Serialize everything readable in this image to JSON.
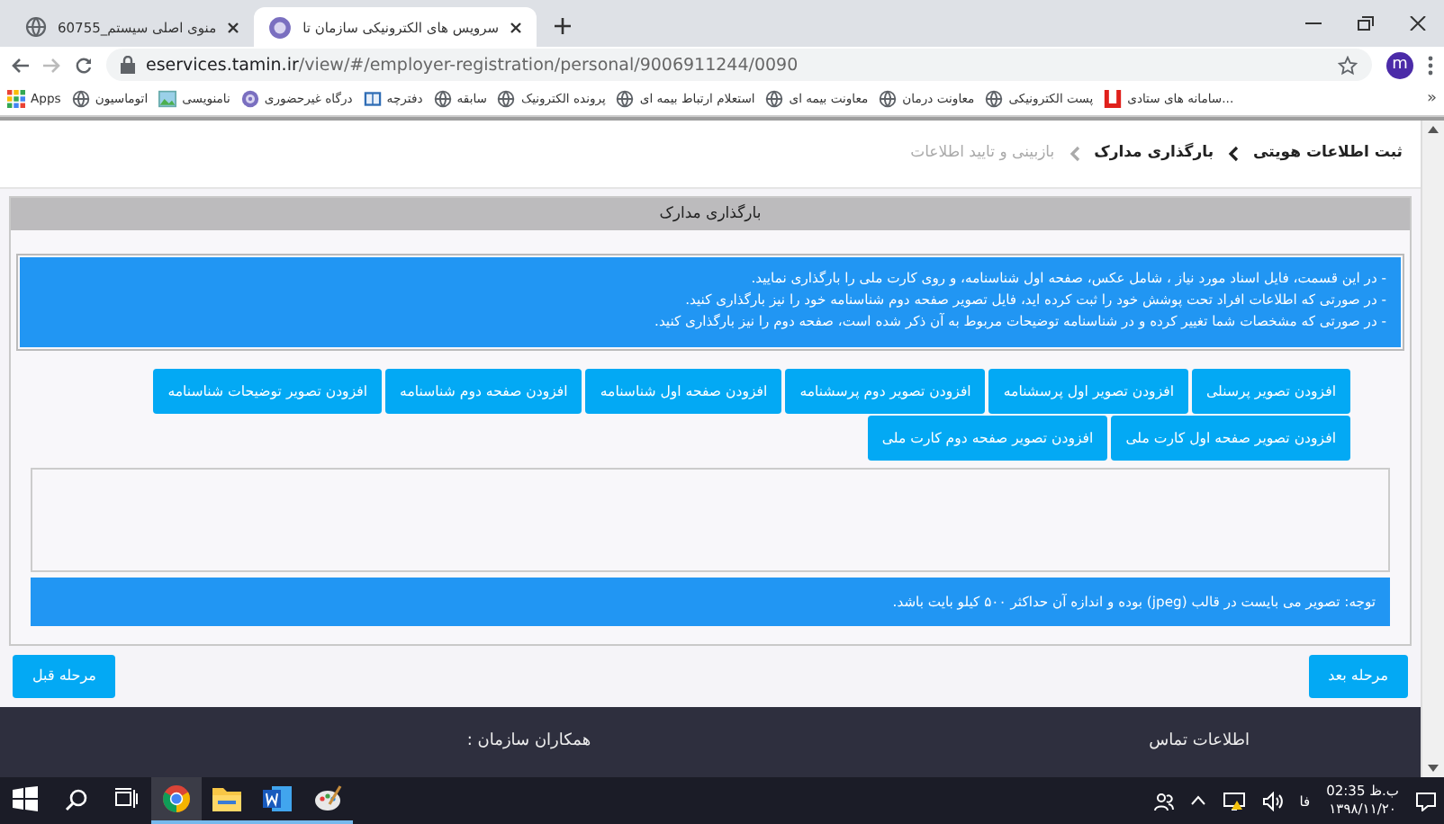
{
  "browser": {
    "tabs": [
      {
        "title": "سرویس های الکترونیکی سازمان تا",
        "selected": true
      },
      {
        "title": "منوی اصلی سیستم_60755",
        "selected": false
      }
    ],
    "url": {
      "host": "eservices.tamin.ir",
      "path": "/view/#/employer-registration/personal/9006911244/0090"
    },
    "avatar": "m",
    "bookmarks": [
      {
        "label": "سامانه های ستادی...",
        "kind": "red"
      },
      {
        "label": "پست الکترونیکی",
        "kind": "globe"
      },
      {
        "label": "معاونت درمان",
        "kind": "globe"
      },
      {
        "label": "معاونت بیمه ای",
        "kind": "globe"
      },
      {
        "label": "استعلام ارتباط بیمه ای",
        "kind": "globe"
      },
      {
        "label": "پرونده الکترونیک",
        "kind": "globe"
      },
      {
        "label": "سابقه",
        "kind": "globe"
      },
      {
        "label": "دفترچه",
        "kind": "book"
      },
      {
        "label": "درگاه غیرحضوری",
        "kind": "seal"
      },
      {
        "label": "نامنویسی",
        "kind": "image"
      },
      {
        "label": "اتوماسیون",
        "kind": "globe"
      },
      {
        "label": "Apps",
        "kind": "apps"
      }
    ],
    "more": "»"
  },
  "page": {
    "steps": [
      {
        "label": "ثبت اطلاعات هویتی",
        "active": true
      },
      {
        "label": "بارگذاری مدارک",
        "active": true
      },
      {
        "label": "بازبینی و تایید اطلاعات",
        "active": false
      }
    ],
    "panel_title": "بارگذاری مدارک",
    "info_lines": [
      "- در این قسمت، فایل اسناد مورد نیاز ، شامل عکس، صفحه اول شناسنامه، و روی کارت ملی را بارگذاری نمایید.",
      "- در صورتی که اطلاعات افراد تحت پوشش خود را ثبت کرده اید، فایل تصویر صفحه دوم شناسنامه خود را نیز بارگذاری کنید.",
      "- در صورتی که مشخصات شما تغییر کرده و در شناسنامه توضیحات مربوط به آن ذکر شده است، صفحه دوم را نیز بارگذاری کنید."
    ],
    "upload_buttons": [
      "افزودن تصویر پرسنلی",
      "افزودن تصویر اول پرسشنامه",
      "افزودن تصویر دوم پرسشنامه",
      "افزودن صفحه اول شناسنامه",
      "افزودن صفحه دوم شناسنامه",
      "افزودن تصویر توضیحات شناسنامه",
      "افزودن تصویر صفحه اول کارت ملی",
      "افزودن تصویر صفحه دوم کارت ملی"
    ],
    "note": "توجه: تصویر می بایست در قالب (jpeg) بوده و اندازه آن حداکثر ۵۰۰ کیلو بایت باشد.",
    "next_button": "مرحله بعد",
    "prev_button": "مرحله قبل",
    "footer": {
      "contact_title": "اطلاعات تماس",
      "partners_title": "همکاران سازمان :"
    }
  },
  "taskbar": {
    "items": [
      {
        "kind": "start",
        "selected": false
      },
      {
        "kind": "search",
        "selected": false
      },
      {
        "kind": "taskview",
        "selected": false
      },
      {
        "kind": "chrome",
        "selected": true
      },
      {
        "kind": "folder",
        "selected": false
      },
      {
        "kind": "word",
        "selected": false
      },
      {
        "kind": "paint",
        "selected": false
      }
    ],
    "language": "فا",
    "time": "02:35 ب.ظ",
    "date": "۱۳۹۸/۱۱/۲۰"
  }
}
